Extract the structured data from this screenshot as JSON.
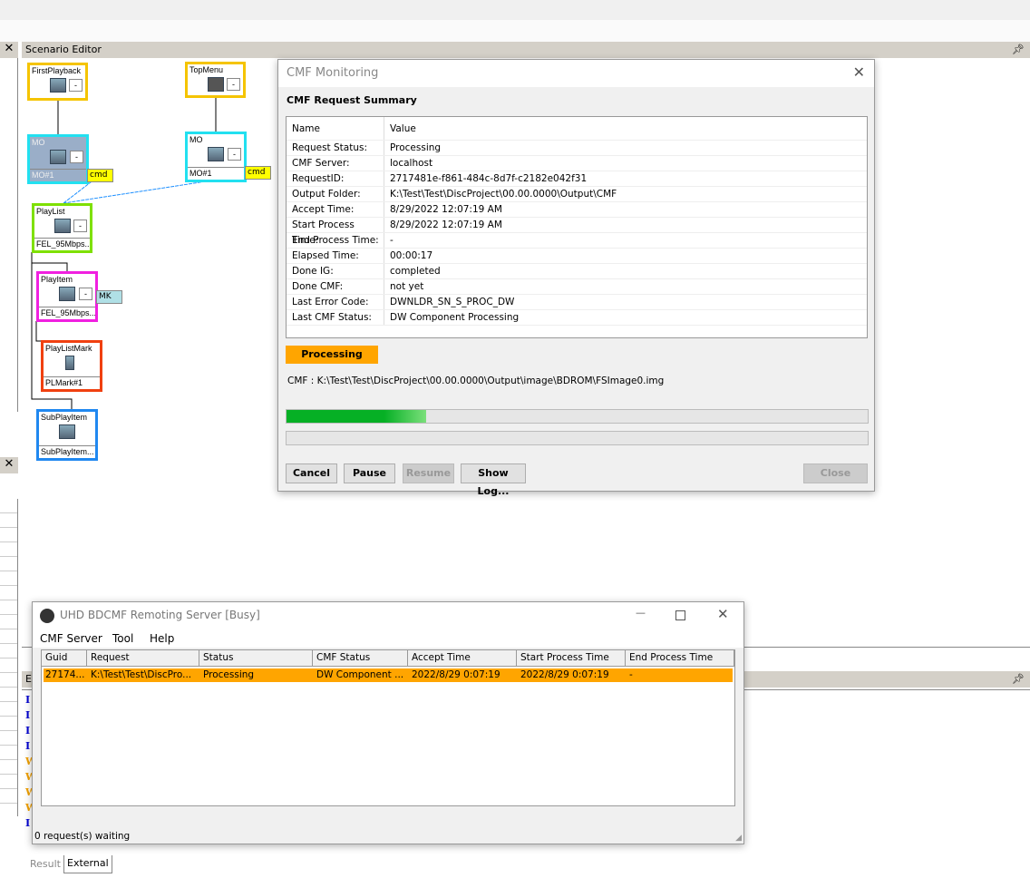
{
  "scenario_editor": {
    "title": "Scenario Editor",
    "nodes": {
      "firstplayback": {
        "title": "FirstPlayback"
      },
      "topmenu": {
        "title": "TopMenu"
      },
      "mo1": {
        "title": "MO",
        "sub": "MO#1",
        "tag": "cmd"
      },
      "mo2": {
        "title": "MO",
        "sub": "MO#1",
        "tag": "cmd"
      },
      "playlist": {
        "title": "PlayList",
        "sub": "FEL_95Mbps..."
      },
      "playitem": {
        "title": "PlayItem",
        "sub": "FEL_95Mbps...",
        "tag": "MK"
      },
      "playlistmark": {
        "title": "PlayListMark",
        "sub": "PLMark#1"
      },
      "subplayitem": {
        "title": "SubPlayItem",
        "sub": "SubPlayItem..."
      }
    },
    "mini_button": "-"
  },
  "output_panel": {
    "header": "Ex",
    "tabs": [
      "Result",
      "External"
    ],
    "log_levels": [
      "I",
      "I",
      "I",
      "I",
      "W",
      "W",
      "W",
      "W",
      "I"
    ]
  },
  "cmf_monitoring": {
    "title": "CMF Monitoring",
    "section": "CMF Request Summary",
    "table": {
      "headers": [
        "Name",
        "Value"
      ],
      "rows": [
        [
          "Request Status:",
          "Processing"
        ],
        [
          "CMF Server:",
          "localhost"
        ],
        [
          "RequestID:",
          "2717481e-f861-484c-8d7f-c2182e042f31"
        ],
        [
          "Output Folder:",
          "K:\\Test\\Test\\DiscProject\\00.00.0000\\Output\\CMF"
        ],
        [
          "Accept Time:",
          "8/29/2022 12:07:19 AM"
        ],
        [
          "Start Process Time:",
          "8/29/2022 12:07:19 AM"
        ],
        [
          "End Process Time:",
          "-"
        ],
        [
          "Elapsed Time:",
          "00:00:17"
        ],
        [
          "Done IG:",
          "completed"
        ],
        [
          "Done CMF:",
          "not yet"
        ],
        [
          "Last Error Code:",
          "DWNLDR_SN_S_PROC_DW"
        ],
        [
          "Last CMF Status:",
          "DW Component Processing"
        ]
      ]
    },
    "status_badge": "Processing",
    "status_color": "#ffa500",
    "cmf_path": "CMF : K:\\Test\\Test\\DiscProject\\00.00.0000\\Output\\image\\BDROM\\FSImage0.img",
    "progress1": 0.24,
    "progress2": 0,
    "buttons": {
      "cancel": "Cancel",
      "pause": "Pause",
      "resume": "Resume",
      "show_log": "Show Log...",
      "close": "Close"
    }
  },
  "remoting_server": {
    "title": "UHD BDCMF Remoting Server [Busy]",
    "menu": [
      "CMF Server",
      "Tool",
      "Help"
    ],
    "columns": [
      "Guid",
      "Request",
      "Status",
      "CMF Status",
      "Accept Time",
      "Start Process Time",
      "End Process Time"
    ],
    "rows": [
      [
        "27174...",
        "K:\\Test\\Test\\DiscPro...",
        "Processing",
        "DW Component ...",
        "2022/8/29 0:07:19",
        "2022/8/29 0:07:19",
        "-"
      ]
    ],
    "status": "0 request(s) waiting",
    "highlight_color": "#ffa500"
  }
}
